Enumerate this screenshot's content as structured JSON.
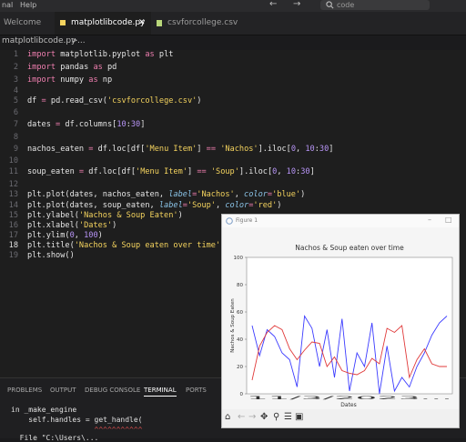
{
  "menu": {
    "item1": "nal",
    "item2": "Help"
  },
  "nav": {
    "back_icon": "←",
    "forward_icon": "→"
  },
  "search": {
    "placeholder": "code",
    "icon": "search-icon"
  },
  "tabs": [
    {
      "label": "Welcome"
    },
    {
      "label": "matplotlibcode.py",
      "close": "✕"
    },
    {
      "label": "csvforcollege.csv"
    }
  ],
  "breadcrumb": {
    "file": "matplotlibcode.py",
    "sep": ">",
    "rest": "..."
  },
  "editor": {
    "line_numbers": [
      "1",
      "2",
      "3",
      "4",
      "5",
      "6",
      "7",
      "8",
      "9",
      "10",
      "11",
      "12",
      "13",
      "14",
      "15",
      "16",
      "17",
      "18",
      "19"
    ]
  },
  "panel": {
    "tabs": [
      "PROBLEMS",
      "OUTPUT",
      "DEBUG CONSOLE",
      "TERMINAL",
      "PORTS"
    ],
    "active_tab": "TERMINAL",
    "lines": [
      "in _make_engine",
      "    self.handles = get_handle(",
      "                   ^^^^^^^^^^^",
      "  File \"C:\\Users\\..."
    ]
  },
  "figure": {
    "window_title": "Figure 1",
    "toolbar_icons": [
      "home-icon",
      "back-icon",
      "forward-icon",
      "pan-icon",
      "zoom-icon",
      "configure-icon",
      "save-icon"
    ]
  },
  "chart_data": {
    "type": "line",
    "title": "Nachos & Soup eaten over time",
    "xlabel": "Dates",
    "ylabel": "Nachos & Soup Eaten",
    "ylim": [
      0,
      100
    ],
    "yticks": [
      "0",
      "20",
      "40",
      "60",
      "80",
      "100"
    ],
    "xtick_text": "11/3/2023...",
    "series": [
      {
        "name": "Nachos",
        "color": "#3b3bff",
        "values": [
          50,
          28,
          47,
          42,
          30,
          25,
          5,
          57,
          48,
          20,
          47,
          12,
          55,
          2,
          30,
          20,
          52,
          0,
          35,
          2,
          12,
          5,
          20,
          30,
          43,
          52,
          57
        ]
      },
      {
        "name": "Soup",
        "color": "#e03a3a",
        "values": [
          10,
          35,
          45,
          50,
          47,
          33,
          25,
          32,
          38,
          37,
          20,
          27,
          17,
          15,
          14,
          17,
          26,
          22,
          48,
          45,
          50,
          12,
          25,
          33,
          22,
          20,
          20
        ]
      }
    ]
  }
}
